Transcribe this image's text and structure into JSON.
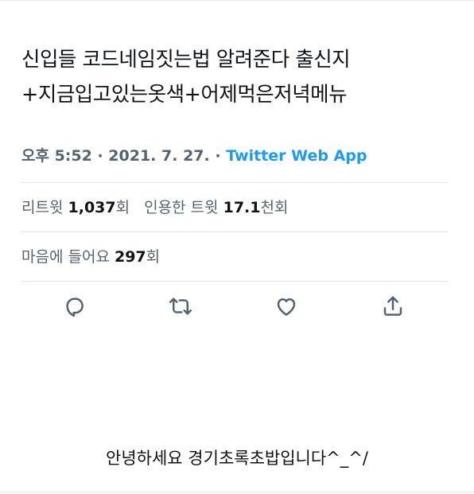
{
  "tweet": {
    "text": "신입들 코드네임짓는법 알려준다 출신지+지금입고있는옷색+어제먹은저녁메뉴",
    "time": "오후 5:52",
    "separator": " · ",
    "date": "2021. 7. 27.",
    "app": "Twitter Web App"
  },
  "stats": {
    "retweets_label": "리트윗",
    "retweets_count": "1,037",
    "retweets_unit": "회",
    "quotes_label": "인용한 트윗",
    "quotes_count": "17.1",
    "quotes_unit": "천회",
    "likes_label": "마음에 들어요",
    "likes_count": "297",
    "likes_unit": "회"
  },
  "actions": {
    "reply_icon": "reply-icon",
    "retweet_icon": "retweet-icon",
    "like_icon": "heart-icon",
    "share_icon": "share-icon"
  },
  "caption": "안녕하세요 경기초록초밥입니다^_^/",
  "colors": {
    "text": "#0f1419",
    "muted": "#536471",
    "link": "#1d9bf0",
    "divider": "#e1e8ed"
  }
}
